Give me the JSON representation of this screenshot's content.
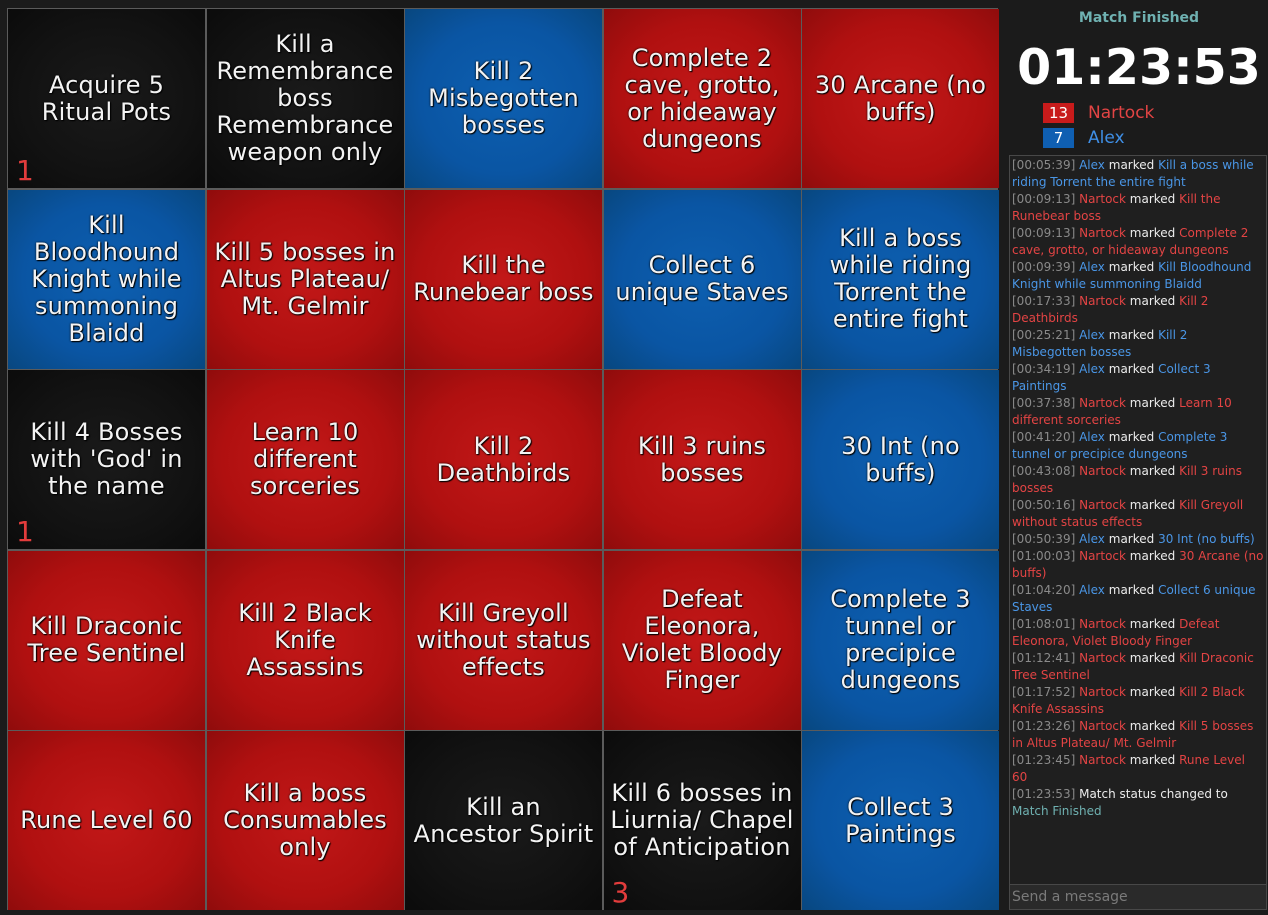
{
  "board": {
    "cells": [
      {
        "text": "Acquire 5 Ritual Pots",
        "color": "black",
        "counter": "1"
      },
      {
        "text": "Kill a Remembrance boss Remembrance weapon only",
        "color": "black",
        "counter": ""
      },
      {
        "text": "Kill 2 Misbegotten bosses",
        "color": "blue",
        "counter": ""
      },
      {
        "text": "Complete 2 cave, grotto, or hideaway dungeons",
        "color": "red",
        "counter": ""
      },
      {
        "text": "30 Arcane (no buffs)",
        "color": "red",
        "counter": ""
      },
      {
        "text": "Kill Bloodhound Knight while summoning Blaidd",
        "color": "blue",
        "counter": ""
      },
      {
        "text": "Kill 5 bosses in Altus Plateau/ Mt. Gelmir",
        "color": "red",
        "counter": ""
      },
      {
        "text": "Kill the Runebear boss",
        "color": "red",
        "counter": ""
      },
      {
        "text": "Collect 6 unique Staves",
        "color": "blue",
        "counter": ""
      },
      {
        "text": "Kill a boss while riding Torrent the entire fight",
        "color": "blue",
        "counter": ""
      },
      {
        "text": "Kill 4 Bosses with 'God' in the name",
        "color": "black",
        "counter": "1"
      },
      {
        "text": "Learn 10 different sorceries",
        "color": "red",
        "counter": ""
      },
      {
        "text": "Kill 2 Deathbirds",
        "color": "red",
        "counter": ""
      },
      {
        "text": "Kill 3 ruins bosses",
        "color": "red",
        "counter": ""
      },
      {
        "text": "30 Int (no buffs)",
        "color": "blue",
        "counter": ""
      },
      {
        "text": "Kill Draconic Tree Sentinel",
        "color": "red",
        "counter": ""
      },
      {
        "text": "Kill 2 Black Knife Assassins",
        "color": "red",
        "counter": ""
      },
      {
        "text": "Kill Greyoll without status effects",
        "color": "red",
        "counter": ""
      },
      {
        "text": "Defeat Eleonora, Violet Bloody Finger",
        "color": "red",
        "counter": ""
      },
      {
        "text": "Complete 3 tunnel or precipice dungeons",
        "color": "blue",
        "counter": ""
      },
      {
        "text": "Rune Level 60",
        "color": "red",
        "counter": ""
      },
      {
        "text": "Kill a boss Consumables only",
        "color": "red",
        "counter": ""
      },
      {
        "text": "Kill an Ancestor Spirit",
        "color": "black",
        "counter": ""
      },
      {
        "text": "Kill 6 bosses in Liurnia/ Chapel of Anticipation",
        "color": "black",
        "counter": "3"
      },
      {
        "text": "Collect 3 Paintings",
        "color": "blue",
        "counter": ""
      }
    ]
  },
  "panel": {
    "status": "Match Finished",
    "timer": "01:23:53",
    "players": [
      {
        "score": "13",
        "name": "Nartock",
        "color": "#c81b1b"
      },
      {
        "score": "7",
        "name": "Alex",
        "color": "#0f5fb2"
      }
    ],
    "log": [
      {
        "time": "[00:05:39]",
        "who": "Alex",
        "team": "blue",
        "verb": "marked",
        "item": "Kill a boss while riding Torrent the entire fight"
      },
      {
        "time": "[00:09:13]",
        "who": "Nartock",
        "team": "red",
        "verb": "marked",
        "item": "Kill the Runebear boss"
      },
      {
        "time": "[00:09:13]",
        "who": "Nartock",
        "team": "red",
        "verb": "marked",
        "item": "Complete 2 cave, grotto, or hideaway dungeons"
      },
      {
        "time": "[00:09:39]",
        "who": "Alex",
        "team": "blue",
        "verb": "marked",
        "item": "Kill Bloodhound Knight while summoning Blaidd"
      },
      {
        "time": "[00:17:33]",
        "who": "Nartock",
        "team": "red",
        "verb": "marked",
        "item": "Kill 2 Deathbirds"
      },
      {
        "time": "[00:25:21]",
        "who": "Alex",
        "team": "blue",
        "verb": "marked",
        "item": "Kill 2 Misbegotten bosses"
      },
      {
        "time": "[00:34:19]",
        "who": "Alex",
        "team": "blue",
        "verb": "marked",
        "item": "Collect 3 Paintings"
      },
      {
        "time": "[00:37:38]",
        "who": "Nartock",
        "team": "red",
        "verb": "marked",
        "item": "Learn 10 different sorceries"
      },
      {
        "time": "[00:41:20]",
        "who": "Alex",
        "team": "blue",
        "verb": "marked",
        "item": "Complete 3 tunnel or precipice dungeons"
      },
      {
        "time": "[00:43:08]",
        "who": "Nartock",
        "team": "red",
        "verb": "marked",
        "item": "Kill 3 ruins bosses"
      },
      {
        "time": "[00:50:16]",
        "who": "Nartock",
        "team": "red",
        "verb": "marked",
        "item": "Kill Greyoll without status effects"
      },
      {
        "time": "[00:50:39]",
        "who": "Alex",
        "team": "blue",
        "verb": "marked",
        "item": "30 Int (no buffs)"
      },
      {
        "time": "[01:00:03]",
        "who": "Nartock",
        "team": "red",
        "verb": "marked",
        "item": "30 Arcane (no buffs)"
      },
      {
        "time": "[01:04:20]",
        "who": "Alex",
        "team": "blue",
        "verb": "marked",
        "item": "Collect 6 unique Staves"
      },
      {
        "time": "[01:08:01]",
        "who": "Nartock",
        "team": "red",
        "verb": "marked",
        "item": "Defeat Eleonora, Violet Bloody Finger"
      },
      {
        "time": "[01:12:41]",
        "who": "Nartock",
        "team": "red",
        "verb": "marked",
        "item": "Kill Draconic Tree Sentinel"
      },
      {
        "time": "[01:17:52]",
        "who": "Nartock",
        "team": "red",
        "verb": "marked",
        "item": "Kill 2 Black Knife Assassins"
      },
      {
        "time": "[01:23:26]",
        "who": "Nartock",
        "team": "red",
        "verb": "marked",
        "item": "Kill 5 bosses in Altus Plateau/ Mt. Gelmir"
      },
      {
        "time": "[01:23:45]",
        "who": "Nartock",
        "team": "red",
        "verb": "marked",
        "item": "Rune Level 60"
      },
      {
        "time": "[01:23:53]",
        "who": "",
        "team": "",
        "verb": "Match status changed to",
        "item": "Match Finished"
      }
    ],
    "chat_placeholder": "Send a message"
  }
}
